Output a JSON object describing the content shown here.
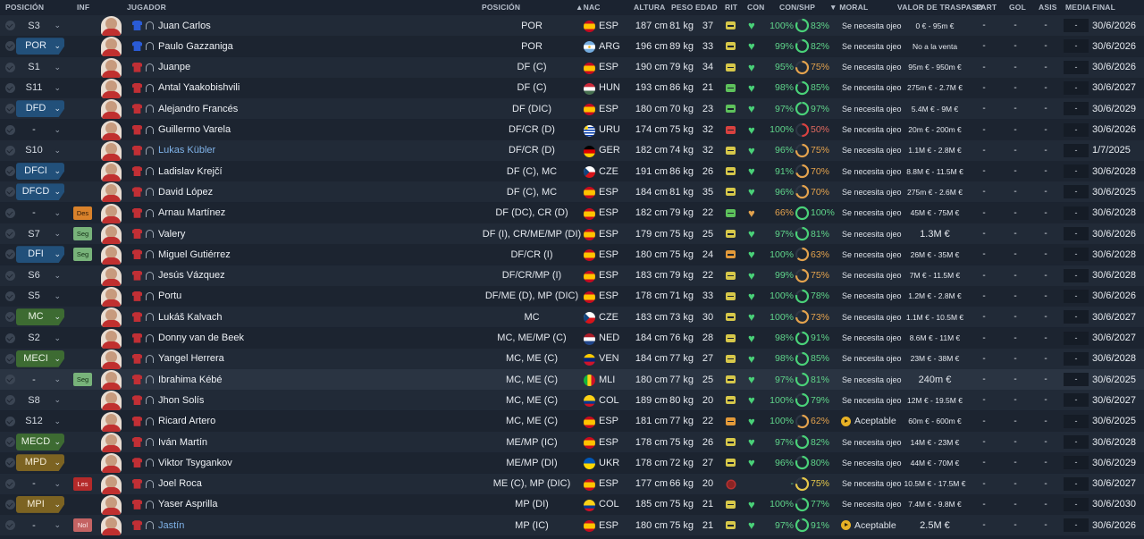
{
  "headers": {
    "posicion": "POSICIÓN",
    "inf": "INF",
    "jugador": "JUGADOR",
    "posicion2": "POSICIÓN",
    "nac": "NAC",
    "altura": "ALTURA",
    "peso": "PESO",
    "edad": "EDAD",
    "rit": "RIT",
    "con": "CON",
    "conshp": "CON/SHP",
    "moral": "MORAL",
    "valor": "VALOR DE TRASPASO",
    "part": "PART",
    "gol": "GOL",
    "asis": "ASIS",
    "media": "MEDIA",
    "final": "FINAL"
  },
  "colors": {
    "pos_blue": "#22507a",
    "pos_green": "#3d6b32",
    "pos_gold": "#7c6322",
    "good": "#49d178",
    "warn": "#e3a24d"
  },
  "players": [
    {
      "pos": "S3",
      "pos_style": "plain",
      "inf": "",
      "kit": "gk",
      "name": "Juan Carlos",
      "link": false,
      "position": "POR",
      "flag": "esp",
      "nat": "ESP",
      "height": "187 cm",
      "weight": "81 kg",
      "age": "37",
      "rit": "y",
      "heart": "g",
      "con": "100%",
      "shp": "83%",
      "shp_v": 0.83,
      "shp_c": "g",
      "morale": "Se necesita ojeo",
      "mor_ic": false,
      "value": "0 € - 95m €",
      "val_big": false,
      "part": "-",
      "gol": "-",
      "asis": "-",
      "media": "-",
      "final": "30/6/2026"
    },
    {
      "pos": "POR",
      "pos_style": "blue",
      "inf": "",
      "kit": "gk",
      "name": "Paulo Gazzaniga",
      "link": false,
      "position": "POR",
      "flag": "arg",
      "nat": "ARG",
      "height": "196 cm",
      "weight": "89 kg",
      "age": "33",
      "rit": "y",
      "heart": "g",
      "con": "99%",
      "shp": "82%",
      "shp_v": 0.82,
      "shp_c": "g",
      "morale": "Se necesita ojeo",
      "mor_ic": false,
      "value": "No a la venta",
      "val_big": false,
      "part": "-",
      "gol": "-",
      "asis": "-",
      "media": "-",
      "final": "30/6/2026"
    },
    {
      "pos": "S1",
      "pos_style": "plain",
      "inf": "",
      "kit": "pl",
      "name": "Juanpe",
      "link": false,
      "position": "DF (C)",
      "flag": "esp",
      "nat": "ESP",
      "height": "190 cm",
      "weight": "79 kg",
      "age": "34",
      "rit": "y",
      "heart": "g",
      "con": "95%",
      "shp": "75%",
      "shp_v": 0.75,
      "shp_c": "o",
      "morale": "Se necesita ojeo",
      "mor_ic": false,
      "value": "95m € - 950m €",
      "val_big": false,
      "part": "-",
      "gol": "-",
      "asis": "-",
      "media": "-",
      "final": "30/6/2026"
    },
    {
      "pos": "S11",
      "pos_style": "plain",
      "inf": "",
      "kit": "pl",
      "name": "Antal Yaakobishvili",
      "link": false,
      "position": "DF (C)",
      "flag": "hun",
      "nat": "HUN",
      "height": "193 cm",
      "weight": "86 kg",
      "age": "21",
      "rit": "g",
      "heart": "g",
      "con": "98%",
      "shp": "85%",
      "shp_v": 0.85,
      "shp_c": "g",
      "morale": "Se necesita ojeo",
      "mor_ic": false,
      "value": "275m € - 2.7M €",
      "val_big": false,
      "part": "-",
      "gol": "-",
      "asis": "-",
      "media": "-",
      "final": "30/6/2027"
    },
    {
      "pos": "DFD",
      "pos_style": "blue",
      "inf": "",
      "kit": "pl",
      "name": "Alejandro Francés",
      "link": false,
      "position": "DF (DIC)",
      "flag": "esp",
      "nat": "ESP",
      "height": "180 cm",
      "weight": "70 kg",
      "age": "23",
      "rit": "g",
      "heart": "g",
      "con": "97%",
      "shp": "97%",
      "shp_v": 0.97,
      "shp_c": "g",
      "morale": "Se necesita ojeo",
      "mor_ic": false,
      "value": "5.4M € - 9M €",
      "val_big": false,
      "part": "-",
      "gol": "-",
      "asis": "-",
      "media": "-",
      "final": "30/6/2029"
    },
    {
      "pos": "-",
      "pos_style": "plain",
      "inf": "",
      "kit": "pl",
      "name": "Guillermo Varela",
      "link": false,
      "position": "DF/CR (D)",
      "flag": "uru",
      "nat": "URU",
      "height": "174 cm",
      "weight": "75 kg",
      "age": "32",
      "rit": "r",
      "heart": "g",
      "con": "100%",
      "shp": "50%",
      "shp_v": 0.5,
      "shp_c": "r",
      "morale": "Se necesita ojeo",
      "mor_ic": false,
      "value": "20m € - 200m €",
      "val_big": false,
      "part": "-",
      "gol": "-",
      "asis": "-",
      "media": "-",
      "final": "30/6/2026"
    },
    {
      "pos": "S10",
      "pos_style": "plain",
      "inf": "",
      "kit": "pl",
      "name": "Lukas Kübler",
      "link": true,
      "position": "DF/CR (D)",
      "flag": "ger",
      "nat": "GER",
      "height": "182 cm",
      "weight": "74 kg",
      "age": "32",
      "rit": "y",
      "heart": "g",
      "con": "96%",
      "shp": "75%",
      "shp_v": 0.75,
      "shp_c": "o",
      "morale": "Se necesita ojeo",
      "mor_ic": false,
      "value": "1.1M € - 2.8M €",
      "val_big": false,
      "part": "-",
      "gol": "-",
      "asis": "-",
      "media": "-",
      "final": "1/7/2025"
    },
    {
      "pos": "DFCI",
      "pos_style": "blue",
      "inf": "",
      "kit": "pl",
      "name": "Ladislav Krejčí",
      "link": false,
      "position": "DF (C), MC",
      "flag": "cze",
      "nat": "CZE",
      "height": "191 cm",
      "weight": "86 kg",
      "age": "26",
      "rit": "y",
      "heart": "g",
      "con": "91%",
      "shp": "70%",
      "shp_v": 0.7,
      "shp_c": "o",
      "morale": "Se necesita ojeo",
      "mor_ic": false,
      "value": "8.8M € - 11.5M €",
      "val_big": false,
      "part": "-",
      "gol": "-",
      "asis": "-",
      "media": "-",
      "final": "30/6/2028"
    },
    {
      "pos": "DFCD",
      "pos_style": "blue",
      "inf": "",
      "kit": "pl",
      "name": "David López",
      "link": false,
      "position": "DF (C), MC",
      "flag": "esp",
      "nat": "ESP",
      "height": "184 cm",
      "weight": "81 kg",
      "age": "35",
      "rit": "y",
      "heart": "g",
      "con": "96%",
      "shp": "70%",
      "shp_v": 0.7,
      "shp_c": "o",
      "morale": "Se necesita ojeo",
      "mor_ic": false,
      "value": "275m € - 2.6M €",
      "val_big": false,
      "part": "-",
      "gol": "-",
      "asis": "-",
      "media": "-",
      "final": "30/6/2025"
    },
    {
      "pos": "-",
      "pos_style": "plain",
      "inf": "Des",
      "inf_c": "des",
      "kit": "pl",
      "name": "Arnau Martínez",
      "link": false,
      "position": "DF (DC), CR (D)",
      "flag": "esp",
      "nat": "ESP",
      "height": "182 cm",
      "weight": "79 kg",
      "age": "22",
      "rit": "g",
      "heart": "o",
      "con": "66%",
      "con_c": "o",
      "shp": "100%",
      "shp_v": 1.0,
      "shp_c": "g",
      "morale": "Se necesita ojeo",
      "mor_ic": false,
      "value": "45M € - 75M €",
      "val_big": false,
      "part": "-",
      "gol": "-",
      "asis": "-",
      "media": "-",
      "final": "30/6/2028"
    },
    {
      "pos": "S7",
      "pos_style": "plain",
      "inf": "Seg",
      "inf_c": "seg",
      "kit": "pl",
      "name": "Valery",
      "link": false,
      "position": "DF (I), CR/ME/MP (DI)",
      "flag": "esp",
      "nat": "ESP",
      "height": "179 cm",
      "weight": "75 kg",
      "age": "25",
      "rit": "y",
      "heart": "g",
      "con": "97%",
      "shp": "81%",
      "shp_v": 0.81,
      "shp_c": "g",
      "morale": "Se necesita ojeo",
      "mor_ic": false,
      "value": "1.3M €",
      "val_big": true,
      "part": "-",
      "gol": "-",
      "asis": "-",
      "media": "-",
      "final": "30/6/2026"
    },
    {
      "pos": "DFI",
      "pos_style": "blue",
      "inf": "Seg",
      "inf_c": "seg",
      "kit": "pl",
      "name": "Miguel Gutiérrez",
      "link": false,
      "position": "DF/CR (I)",
      "flag": "esp",
      "nat": "ESP",
      "height": "180 cm",
      "weight": "75 kg",
      "age": "24",
      "rit": "o",
      "heart": "g",
      "con": "100%",
      "shp": "63%",
      "shp_v": 0.63,
      "shp_c": "o",
      "morale": "Se necesita ojeo",
      "mor_ic": false,
      "value": "26M € - 35M €",
      "val_big": false,
      "part": "-",
      "gol": "-",
      "asis": "-",
      "media": "-",
      "final": "30/6/2028"
    },
    {
      "pos": "S6",
      "pos_style": "plain",
      "inf": "",
      "kit": "pl",
      "name": "Jesús Vázquez",
      "link": false,
      "position": "DF/CR/MP (I)",
      "flag": "esp",
      "nat": "ESP",
      "height": "183 cm",
      "weight": "79 kg",
      "age": "22",
      "rit": "y",
      "heart": "g",
      "con": "99%",
      "shp": "75%",
      "shp_v": 0.75,
      "shp_c": "o",
      "morale": "Se necesita ojeo",
      "mor_ic": false,
      "value": "7M € - 11.5M €",
      "val_big": false,
      "part": "-",
      "gol": "-",
      "asis": "-",
      "media": "-",
      "final": "30/6/2028"
    },
    {
      "pos": "S5",
      "pos_style": "plain",
      "inf": "",
      "kit": "pl",
      "name": "Portu",
      "link": false,
      "position": "DF/ME (D), MP (DIC)",
      "flag": "esp",
      "nat": "ESP",
      "height": "178 cm",
      "weight": "71 kg",
      "age": "33",
      "rit": "y",
      "heart": "g",
      "con": "100%",
      "shp": "78%",
      "shp_v": 0.78,
      "shp_c": "g",
      "morale": "Se necesita ojeo",
      "mor_ic": false,
      "value": "1.2M € - 2.8M €",
      "val_big": false,
      "part": "-",
      "gol": "-",
      "asis": "-",
      "media": "-",
      "final": "30/6/2026"
    },
    {
      "pos": "MC",
      "pos_style": "green",
      "inf": "",
      "kit": "pl",
      "name": "Lukáš Kalvach",
      "link": false,
      "position": "MC",
      "flag": "cze",
      "nat": "CZE",
      "height": "183 cm",
      "weight": "73 kg",
      "age": "30",
      "rit": "y",
      "heart": "g",
      "con": "100%",
      "shp": "73%",
      "shp_v": 0.73,
      "shp_c": "o",
      "morale": "Se necesita ojeo",
      "mor_ic": false,
      "value": "1.1M € - 10.5M €",
      "val_big": false,
      "part": "-",
      "gol": "-",
      "asis": "-",
      "media": "-",
      "final": "30/6/2027"
    },
    {
      "pos": "S2",
      "pos_style": "plain",
      "inf": "",
      "kit": "pl",
      "name": "Donny van de Beek",
      "link": false,
      "position": "MC, ME/MP (C)",
      "flag": "ned",
      "nat": "NED",
      "height": "184 cm",
      "weight": "76 kg",
      "age": "28",
      "rit": "y",
      "heart": "g",
      "con": "98%",
      "shp": "91%",
      "shp_v": 0.91,
      "shp_c": "g",
      "morale": "Se necesita ojeo",
      "mor_ic": false,
      "value": "8.6M € - 11M €",
      "val_big": false,
      "part": "-",
      "gol": "-",
      "asis": "-",
      "media": "-",
      "final": "30/6/2027"
    },
    {
      "pos": "MECI",
      "pos_style": "green",
      "inf": "",
      "kit": "pl",
      "name": "Yangel Herrera",
      "link": false,
      "position": "MC, ME (C)",
      "flag": "ven",
      "nat": "VEN",
      "height": "184 cm",
      "weight": "77 kg",
      "age": "27",
      "rit": "y",
      "heart": "g",
      "con": "98%",
      "shp": "85%",
      "shp_v": 0.85,
      "shp_c": "g",
      "morale": "Se necesita ojeo",
      "mor_ic": false,
      "value": "23M € - 38M €",
      "val_big": false,
      "part": "-",
      "gol": "-",
      "asis": "-",
      "media": "-",
      "final": "30/6/2028"
    },
    {
      "pos": "-",
      "pos_style": "plain",
      "inf": "Seg",
      "inf_c": "seg",
      "kit": "pl",
      "name": "Ibrahima Kébé",
      "link": false,
      "position": "MC, ME (C)",
      "flag": "mli",
      "nat": "MLI",
      "height": "180 cm",
      "weight": "77 kg",
      "age": "25",
      "rit": "y",
      "heart": "g",
      "con": "97%",
      "shp": "81%",
      "shp_v": 0.81,
      "shp_c": "g",
      "morale": "Se necesita ojeo",
      "mor_ic": false,
      "value": "240m €",
      "val_big": true,
      "part": "-",
      "gol": "-",
      "asis": "-",
      "media": "-",
      "final": "30/6/2025",
      "hl": true
    },
    {
      "pos": "S8",
      "pos_style": "plain",
      "inf": "",
      "kit": "pl",
      "name": "Jhon Solís",
      "link": false,
      "position": "MC, ME (C)",
      "flag": "col",
      "nat": "COL",
      "height": "189 cm",
      "weight": "80 kg",
      "age": "20",
      "rit": "y",
      "heart": "g",
      "con": "100%",
      "shp": "79%",
      "shp_v": 0.79,
      "shp_c": "g",
      "morale": "Se necesita ojeo",
      "mor_ic": false,
      "value": "12M € - 19.5M €",
      "val_big": false,
      "part": "-",
      "gol": "-",
      "asis": "-",
      "media": "-",
      "final": "30/6/2027"
    },
    {
      "pos": "S12",
      "pos_style": "plain",
      "inf": "",
      "kit": "pl",
      "name": "Ricard Artero",
      "link": false,
      "position": "MC, ME (C)",
      "flag": "esp",
      "nat": "ESP",
      "height": "181 cm",
      "weight": "77 kg",
      "age": "22",
      "rit": "o",
      "heart": "g",
      "con": "100%",
      "shp": "62%",
      "shp_v": 0.62,
      "shp_c": "o",
      "morale": "Aceptable",
      "mor_ic": true,
      "value": "60m € - 600m €",
      "val_big": false,
      "part": "-",
      "gol": "-",
      "asis": "-",
      "media": "-",
      "final": "30/6/2025"
    },
    {
      "pos": "MECD",
      "pos_style": "green",
      "inf": "",
      "kit": "pl",
      "name": "Iván Martín",
      "link": false,
      "position": "ME/MP (IC)",
      "flag": "esp",
      "nat": "ESP",
      "height": "178 cm",
      "weight": "75 kg",
      "age": "26",
      "rit": "y",
      "heart": "g",
      "con": "97%",
      "shp": "82%",
      "shp_v": 0.82,
      "shp_c": "g",
      "morale": "Se necesita ojeo",
      "mor_ic": false,
      "value": "14M € - 23M €",
      "val_big": false,
      "part": "-",
      "gol": "-",
      "asis": "-",
      "media": "-",
      "final": "30/6/2028"
    },
    {
      "pos": "MPD",
      "pos_style": "gold",
      "inf": "",
      "kit": "pl",
      "name": "Viktor Tsygankov",
      "link": false,
      "position": "ME/MP (DI)",
      "flag": "ukr",
      "nat": "UKR",
      "height": "178 cm",
      "weight": "72 kg",
      "age": "27",
      "rit": "y",
      "heart": "g",
      "con": "96%",
      "shp": "80%",
      "shp_v": 0.8,
      "shp_c": "g",
      "morale": "Se necesita ojeo",
      "mor_ic": false,
      "value": "44M € - 70M €",
      "val_big": false,
      "part": "-",
      "gol": "-",
      "asis": "-",
      "media": "-",
      "final": "30/6/2029"
    },
    {
      "pos": "-",
      "pos_style": "plain",
      "inf": "Les",
      "inf_c": "les",
      "kit": "pl",
      "name": "Joel Roca",
      "link": false,
      "position": "ME (C), MP (DIC)",
      "flag": "esp",
      "nat": "ESP",
      "height": "177 cm",
      "weight": "66 kg",
      "age": "20",
      "rit": "dot",
      "heart": "none",
      "con": "-",
      "shp": "75%",
      "shp_v": 0.75,
      "shp_c": "y",
      "morale": "Se necesita ojeo",
      "mor_ic": false,
      "value": "10.5M € - 17.5M €",
      "val_big": false,
      "part": "-",
      "gol": "-",
      "asis": "-",
      "media": "-",
      "final": "30/6/2027"
    },
    {
      "pos": "MPI",
      "pos_style": "gold",
      "inf": "",
      "kit": "pl",
      "name": "Yaser Asprilla",
      "link": false,
      "position": "MP (DI)",
      "flag": "col",
      "nat": "COL",
      "height": "185 cm",
      "weight": "75 kg",
      "age": "21",
      "rit": "y",
      "heart": "g",
      "con": "100%",
      "shp": "77%",
      "shp_v": 0.77,
      "shp_c": "g",
      "morale": "Se necesita ojeo",
      "mor_ic": false,
      "value": "7.4M € - 9.8M €",
      "val_big": false,
      "part": "-",
      "gol": "-",
      "asis": "-",
      "media": "-",
      "final": "30/6/2030"
    },
    {
      "pos": "-",
      "pos_style": "plain",
      "inf": "Nol",
      "inf_c": "nol",
      "kit": "pl",
      "name": "Jastín",
      "link": true,
      "position": "MP (IC)",
      "flag": "esp",
      "nat": "ESP",
      "height": "180 cm",
      "weight": "75 kg",
      "age": "21",
      "rit": "y",
      "heart": "g",
      "con": "97%",
      "shp": "91%",
      "shp_v": 0.91,
      "shp_c": "g",
      "morale": "Aceptable",
      "mor_ic": true,
      "value": "2.5M €",
      "val_big": true,
      "part": "-",
      "gol": "-",
      "asis": "-",
      "media": "-",
      "final": "30/6/2026"
    }
  ]
}
